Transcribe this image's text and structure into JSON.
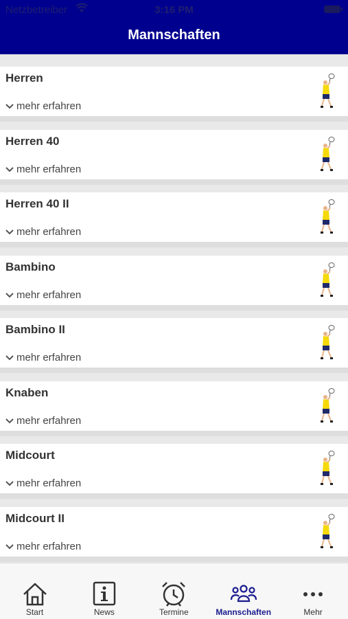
{
  "status": {
    "carrier": "Netzbetreiber",
    "time": "3:16 PM"
  },
  "header": {
    "title": "Mannschaften"
  },
  "teams": [
    {
      "name": "Herren",
      "more": "mehr erfahren"
    },
    {
      "name": "Herren 40",
      "more": "mehr erfahren"
    },
    {
      "name": "Herren 40 II",
      "more": "mehr erfahren"
    },
    {
      "name": "Bambino",
      "more": "mehr erfahren"
    },
    {
      "name": "Bambino II",
      "more": "mehr erfahren"
    },
    {
      "name": "Knaben",
      "more": "mehr erfahren"
    },
    {
      "name": "Midcourt",
      "more": "mehr erfahren"
    },
    {
      "name": "Midcourt II",
      "more": "mehr erfahren"
    }
  ],
  "tabs": [
    {
      "label": "Start",
      "icon": "home-icon"
    },
    {
      "label": "News",
      "icon": "info-icon"
    },
    {
      "label": "Termine",
      "icon": "alarm-clock-icon"
    },
    {
      "label": "Mannschaften",
      "icon": "group-icon",
      "active": true
    },
    {
      "label": "Mehr",
      "icon": "more-dots-icon"
    }
  ],
  "colors": {
    "header_bg": "#00008f",
    "active_tab": "#1a1a8e",
    "player_shirt": "#f5d90a",
    "player_shorts": "#1f2a6b"
  }
}
